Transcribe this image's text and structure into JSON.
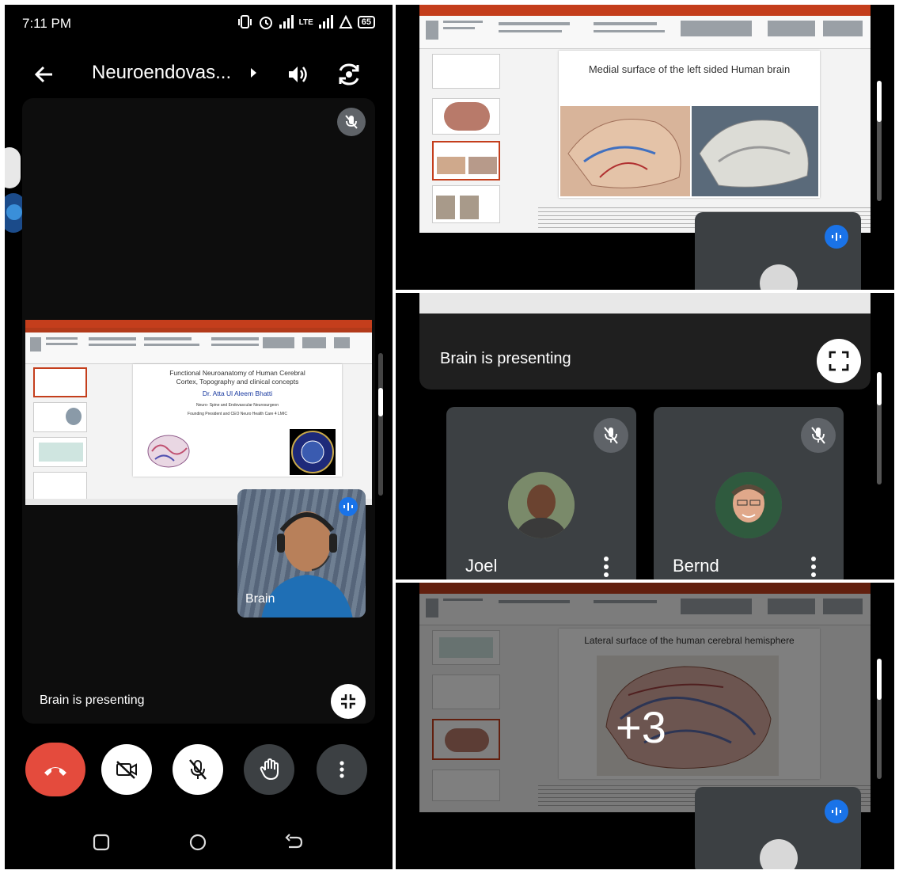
{
  "status_bar": {
    "time": "7:11 PM",
    "network_label": "LTE",
    "battery": "65"
  },
  "call_header": {
    "title": "Neuroendovas...",
    "chevron": "chevron-right-icon"
  },
  "main_stage": {
    "presenting_label": "Brain is presenting",
    "pip_name": "Brain"
  },
  "slide_title_main": {
    "title_line1": "Functional Neuroanatomy of Human Cerebral",
    "title_line2": "Cortex, Topography and clinical concepts",
    "author": "Dr. Atta Ul Aleem Bhatti",
    "line3": "Neuro- Spine and Endovascular Neurosurgeon",
    "line4": "Founding President and CEO Neuro Health Care 4 LMIC"
  },
  "slide_medial": {
    "title": "Medial surface of the left sided Human brain"
  },
  "slide_lateral": {
    "title": "Lateral surface of the human cerebral hemisphere",
    "overlay_count": "+3"
  },
  "grid_panel": {
    "presenting_label": "Brain is presenting",
    "participants": [
      {
        "name": "Joel"
      },
      {
        "name": "Bernd"
      }
    ]
  },
  "colors": {
    "end_call": "#e44b3d",
    "tile_bg": "#3c4043",
    "ppt_ribbon": "#c43e1c",
    "white_btn": "#ffffff",
    "dark_btn": "#3c4043"
  }
}
